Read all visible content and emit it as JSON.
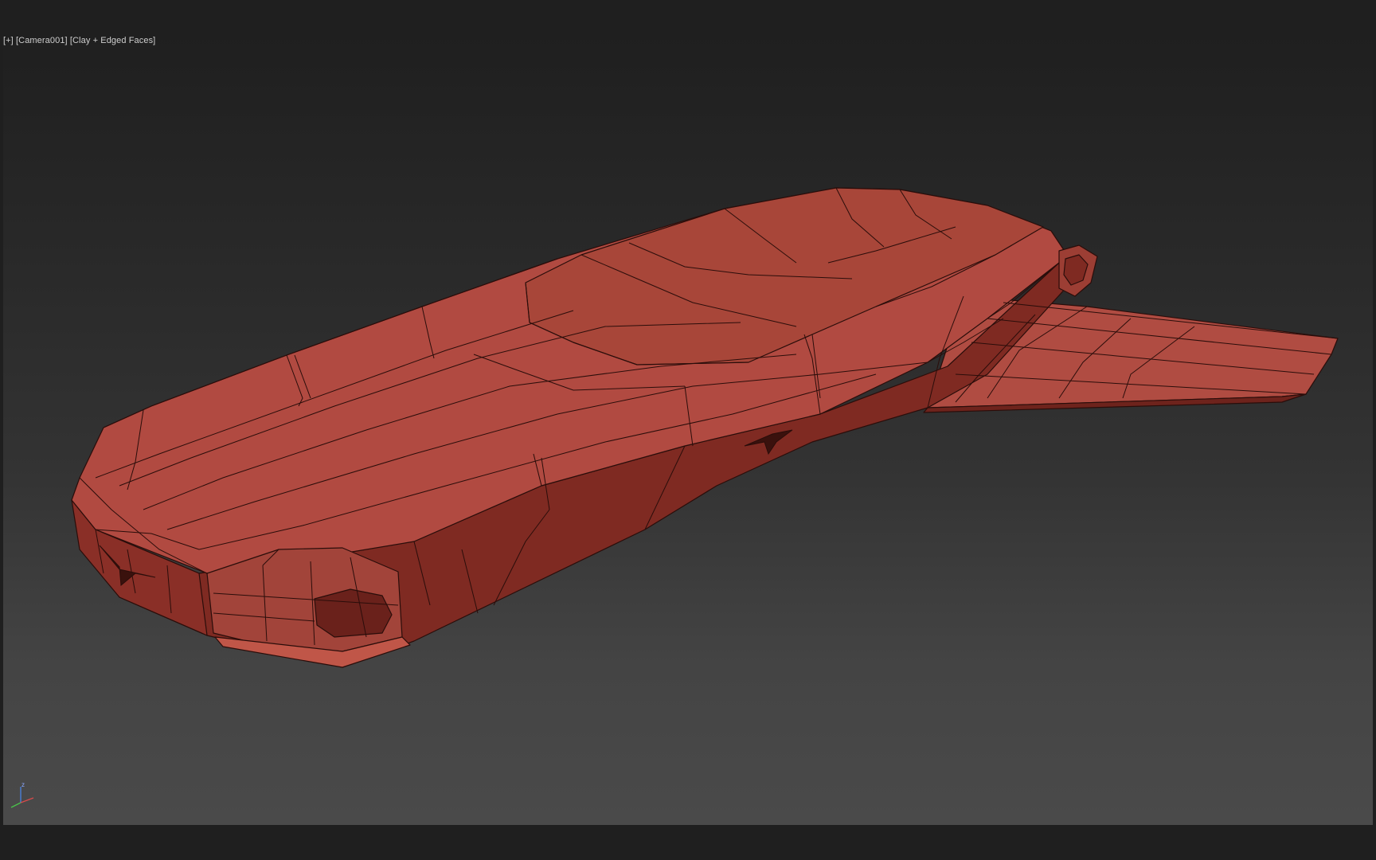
{
  "viewport": {
    "label": {
      "plus": "[+]",
      "camera": "[Camera001]",
      "shading": "[Clay + Edged Faces]"
    },
    "colors": {
      "background_top": "#1f1f1f",
      "background_bottom": "#4a4a4a",
      "model_face": "#b44a40",
      "model_shadow": "#7f2a22",
      "edge": "#2a0d0a"
    },
    "gizmo": {
      "z_label": "z"
    }
  }
}
